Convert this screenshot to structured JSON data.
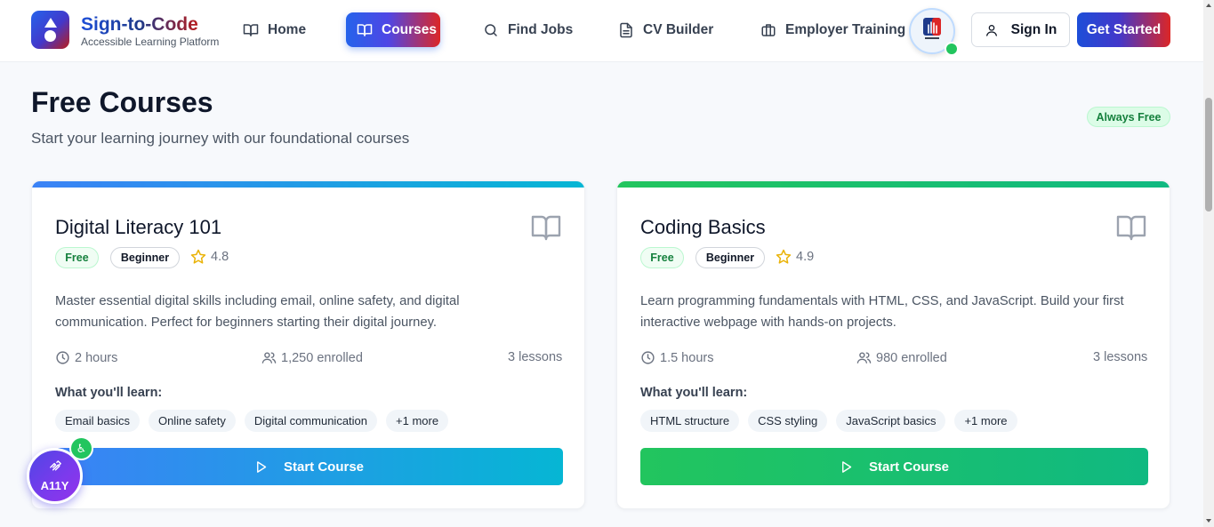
{
  "brand": {
    "title": "Sign-to-Code",
    "subtitle": "Accessible Learning Platform"
  },
  "nav": {
    "items": [
      {
        "label": "Home",
        "icon": "book-open-icon",
        "active": false
      },
      {
        "label": "Courses",
        "icon": "book-open-icon",
        "active": true
      },
      {
        "label": "Find Jobs",
        "icon": "search-icon",
        "active": false
      },
      {
        "label": "CV Builder",
        "icon": "document-icon",
        "active": false
      },
      {
        "label": "Employer Training",
        "icon": "briefcase-icon",
        "active": false
      }
    ],
    "sign_in": "Sign In",
    "get_started": "Get Started"
  },
  "section": {
    "title": "Free Courses",
    "subtitle": "Start your learning journey with our foundational courses",
    "badge": "Always Free"
  },
  "courses": [
    {
      "title": "Digital Literacy 101",
      "price_badge": "Free",
      "level": "Beginner",
      "rating": "4.8",
      "description": "Master essential digital skills including email, online safety, and digital communication. Perfect for beginners starting their digital journey.",
      "duration": "2 hours",
      "enrolled": "1,250 enrolled",
      "lessons": "3 lessons",
      "learn_label": "What you'll learn:",
      "topics": [
        "Email basics",
        "Online safety",
        "Digital communication",
        "+1 more"
      ],
      "button": "Start Course",
      "accent": "#2563eb"
    },
    {
      "title": "Coding Basics",
      "price_badge": "Free",
      "level": "Beginner",
      "rating": "4.9",
      "description": "Learn programming fundamentals with HTML, CSS, and JavaScript. Build your first interactive webpage with hands-on projects.",
      "duration": "1.5 hours",
      "enrolled": "980 enrolled",
      "lessons": "3 lessons",
      "learn_label": "What you'll learn:",
      "topics": [
        "HTML structure",
        "CSS styling",
        "JavaScript basics",
        "+1 more"
      ],
      "button": "Start Course",
      "accent": "#22c55e"
    }
  ],
  "a11y": {
    "label": "A11Y",
    "badge": "♿"
  }
}
